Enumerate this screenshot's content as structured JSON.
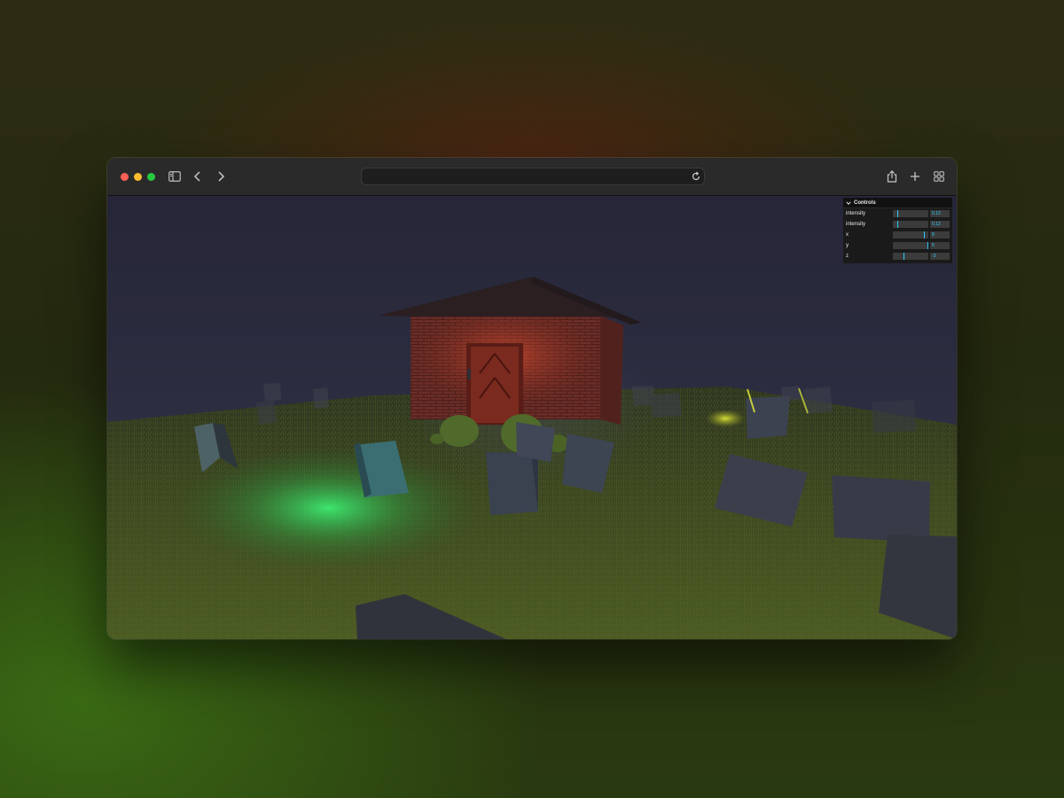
{
  "window": {
    "traffic_lights": {
      "close": "#ff5f57",
      "minimize": "#febc2e",
      "maximize": "#28c840"
    },
    "toolbar_icons": [
      "sidebar-icon",
      "chevron-left-icon",
      "chevron-right-icon",
      "reload-icon",
      "share-icon",
      "plus-icon",
      "tab-overview-icon"
    ],
    "address_bar": {
      "value": ""
    }
  },
  "controls": {
    "title": "Controls",
    "rows": [
      {
        "label": "intensity",
        "value": "0.12",
        "level": 0.12
      },
      {
        "label": "intensity",
        "value": "0.12",
        "level": 0.12
      },
      {
        "label": "x",
        "value": "8",
        "level": 0.9
      },
      {
        "label": "y",
        "value": "5",
        "level": 0.99
      },
      {
        "label": "z",
        "value": "-3",
        "level": 0.3
      }
    ]
  },
  "scene": {
    "sky_color": "#2a2b40",
    "ground_color": "#3b4a1c",
    "ghost_light_colors": [
      "#3aff72",
      "#dfe83a"
    ],
    "door_light_color": "#ff4a2a"
  }
}
